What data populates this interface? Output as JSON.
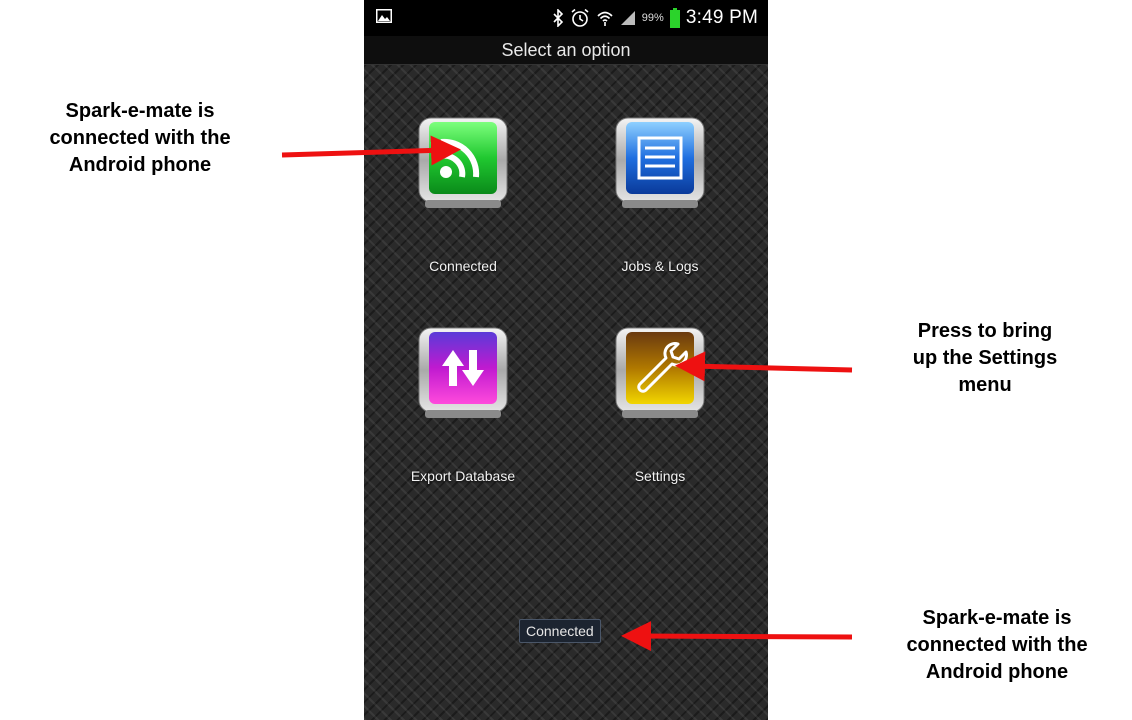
{
  "status_bar": {
    "battery_percent": "99%",
    "time": "3:49 PM",
    "icons": [
      "gallery-icon",
      "bluetooth-icon",
      "alarm-icon",
      "wifi-icon",
      "signal-icon",
      "battery-icon"
    ]
  },
  "app": {
    "title": "Select an option",
    "tiles": [
      {
        "label": "Connected",
        "icon": "rss-connected-icon",
        "color": "#22c43a"
      },
      {
        "label": "Jobs & Logs",
        "icon": "document-icon",
        "color": "#1f6fe0"
      },
      {
        "label": "Export Database",
        "icon": "up-down-arrows-icon",
        "color": "#c01ad0"
      },
      {
        "label": "Settings",
        "icon": "wrench-icon",
        "color": "#b07800"
      }
    ],
    "toast": "Connected"
  },
  "annotations": {
    "top_left": [
      "Spark-e-mate is",
      "connected with the",
      "Android phone"
    ],
    "mid_right": [
      "Press to bring",
      "up the Settings",
      "menu"
    ],
    "bottom_right": [
      "Spark-e-mate is",
      "connected with the",
      "Android phone"
    ],
    "arrow_color": "#ee1111"
  }
}
